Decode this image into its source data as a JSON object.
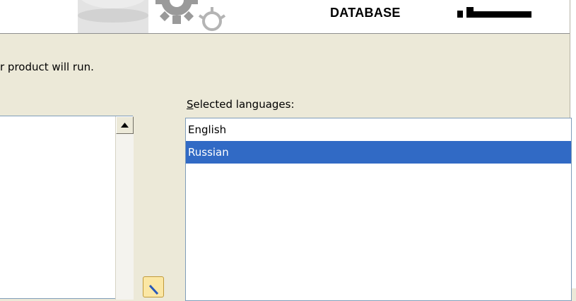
{
  "banner": {
    "word": "DATABASE",
    "logo_icon": "oracle-logo-mark"
  },
  "instruction_text": "r product will run.",
  "selected_languages": {
    "label_accel": "S",
    "label_rest": "elected languages:",
    "items": [
      {
        "label": "English"
      },
      {
        "label": "Russian"
      }
    ],
    "selected_index": 1
  },
  "available_list": {
    "scroll_up_icon": "triangle-up-icon"
  },
  "move_button": {
    "icon": "pencil-arrow-icon"
  },
  "colors": {
    "selection": "#316ac5",
    "background": "#ece9d8",
    "list_border": "#7f9db9"
  }
}
